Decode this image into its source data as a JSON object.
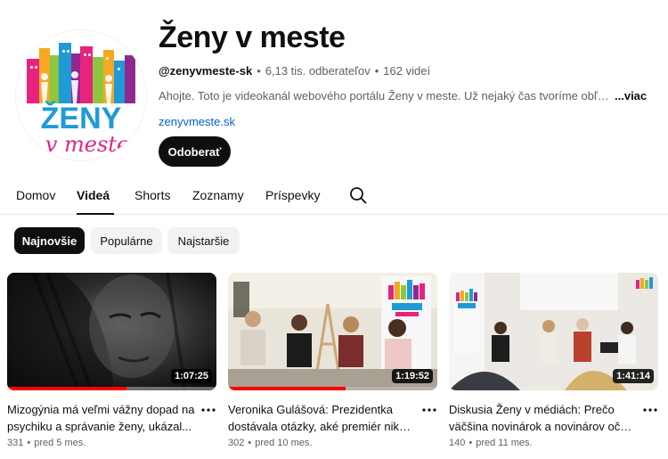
{
  "channel": {
    "title": "Ženy v meste",
    "handle": "@zenyvmeste-sk",
    "subscribers": "6,13 tis. odberateľov",
    "videos_count": "162 videí",
    "description": "Ahojte. Toto je videokanál webového portálu Ženy v meste. Už nejaký čas tvoríme obľúbené",
    "more_label": "...viac",
    "link": "zenyvmeste.sk",
    "subscribe_label": "Odoberať",
    "logo_text_top": "ŽENY",
    "logo_text_bottom": "v meste"
  },
  "tabs": [
    {
      "label": "Domov"
    },
    {
      "label": "Videá"
    },
    {
      "label": "Shorts"
    },
    {
      "label": "Zoznamy"
    },
    {
      "label": "Príspevky"
    }
  ],
  "chips": [
    {
      "label": "Najnovšie"
    },
    {
      "label": "Populárne"
    },
    {
      "label": "Najstaršie"
    }
  ],
  "videos": [
    {
      "title_line1": "Mizogýnia má veľmi vážny dopad na",
      "title_line2": "psychiku a správanie ženy, ukázal...",
      "duration": "1:07:25",
      "views": "331",
      "age": "pred 5 mes.",
      "watched_fraction": 0.57
    },
    {
      "title_line1": "Veronika Gulášová: Prezidentka",
      "title_line2": "dostávala otázky, aké premiér nikdy...",
      "duration": "1:19:52",
      "views": "302",
      "age": "pred 10 mes.",
      "watched_fraction": 0.56
    },
    {
      "title_line1": "Diskusia Ženy v médiách:  Prečo",
      "title_line2": "väčšina novinárok a novinárov očak...",
      "duration": "1:41:14",
      "views": "140",
      "age": "pred 11 mes.",
      "watched_fraction": 0
    }
  ],
  "separator": "•",
  "colors": {
    "accent": "#0f0f0f",
    "link": "#065fd4",
    "progress": "#ff0000",
    "logo_blue": "#1e9bd7",
    "logo_pink": "#e6237e"
  },
  "icons": {
    "tab_search": "search-icon",
    "menu": "more-vert-icon"
  }
}
